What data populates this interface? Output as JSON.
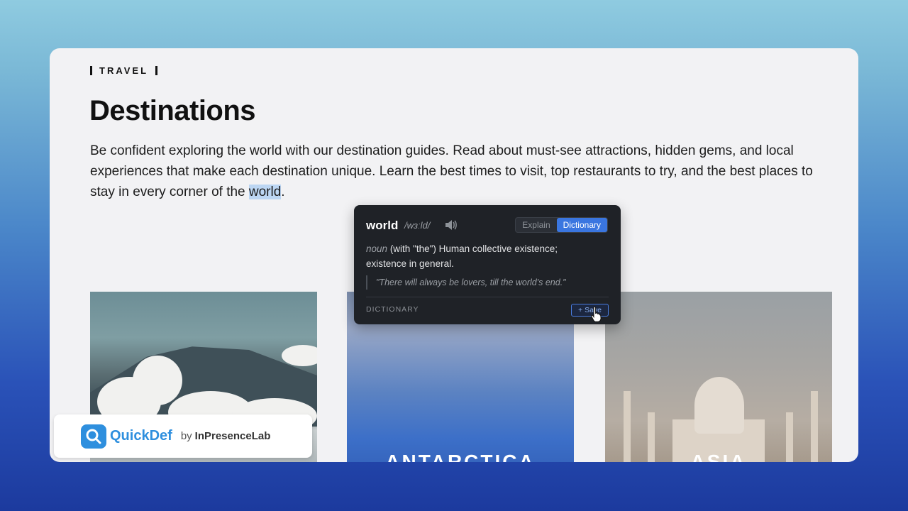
{
  "article": {
    "eyebrow": "TRAVEL",
    "title": "Destinations",
    "intro_before": "Be confident exploring the world with our destination guides. Read about must-see attractions, hidden gems, and local experiences that make each destination unique. Learn the best times to visit, top restaurants to try, and the best places to stay in every corner of the ",
    "intro_highlight": "world",
    "intro_after": "."
  },
  "cards": [
    {
      "label": ""
    },
    {
      "label": "ANTARCTICA"
    },
    {
      "label": "ASIA"
    }
  ],
  "popup": {
    "word": "world",
    "pronunciation": "/wɜːld/",
    "tabs": [
      "Explain",
      "Dictionary"
    ],
    "active_tab": "Dictionary",
    "part_of_speech": "noun",
    "definition": "(with \"the\") Human collective existence; existence in general.",
    "example": "\"There will always be lovers, till the world's end.\"",
    "source": "DICTIONARY",
    "save_label": "+ Save",
    "accent_color": "#3a76e0"
  },
  "brand": {
    "name": "QuickDef",
    "by": "by",
    "company": "InPresenceLab",
    "color": "#2e8fde"
  }
}
